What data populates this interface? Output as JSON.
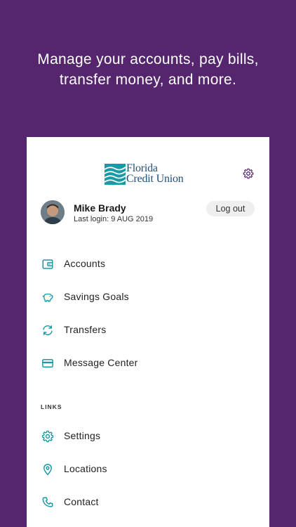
{
  "headline": {
    "line1": "Manage your accounts, pay bills,",
    "line2": "transfer money, and more."
  },
  "brand": {
    "line1": "Florida",
    "line2": "Credit Union",
    "color": "#1d4f79",
    "accent": "#1a9aa6",
    "background": "#55256e"
  },
  "user": {
    "name": "Mike Brady",
    "last_login": "Last login: 9 AUG 2019",
    "logout_label": "Log out"
  },
  "main_menu": [
    {
      "label": "Accounts",
      "icon": "wallet-icon"
    },
    {
      "label": "Savings Goals",
      "icon": "piggy-bank-icon"
    },
    {
      "label": "Transfers",
      "icon": "refresh-icon"
    },
    {
      "label": "Message Center",
      "icon": "credit-card-icon"
    }
  ],
  "links_section": {
    "title": "LINKS",
    "items": [
      {
        "label": "Settings",
        "icon": "gear-icon"
      },
      {
        "label": "Locations",
        "icon": "location-pin-icon"
      },
      {
        "label": "Contact",
        "icon": "phone-icon"
      }
    ]
  }
}
